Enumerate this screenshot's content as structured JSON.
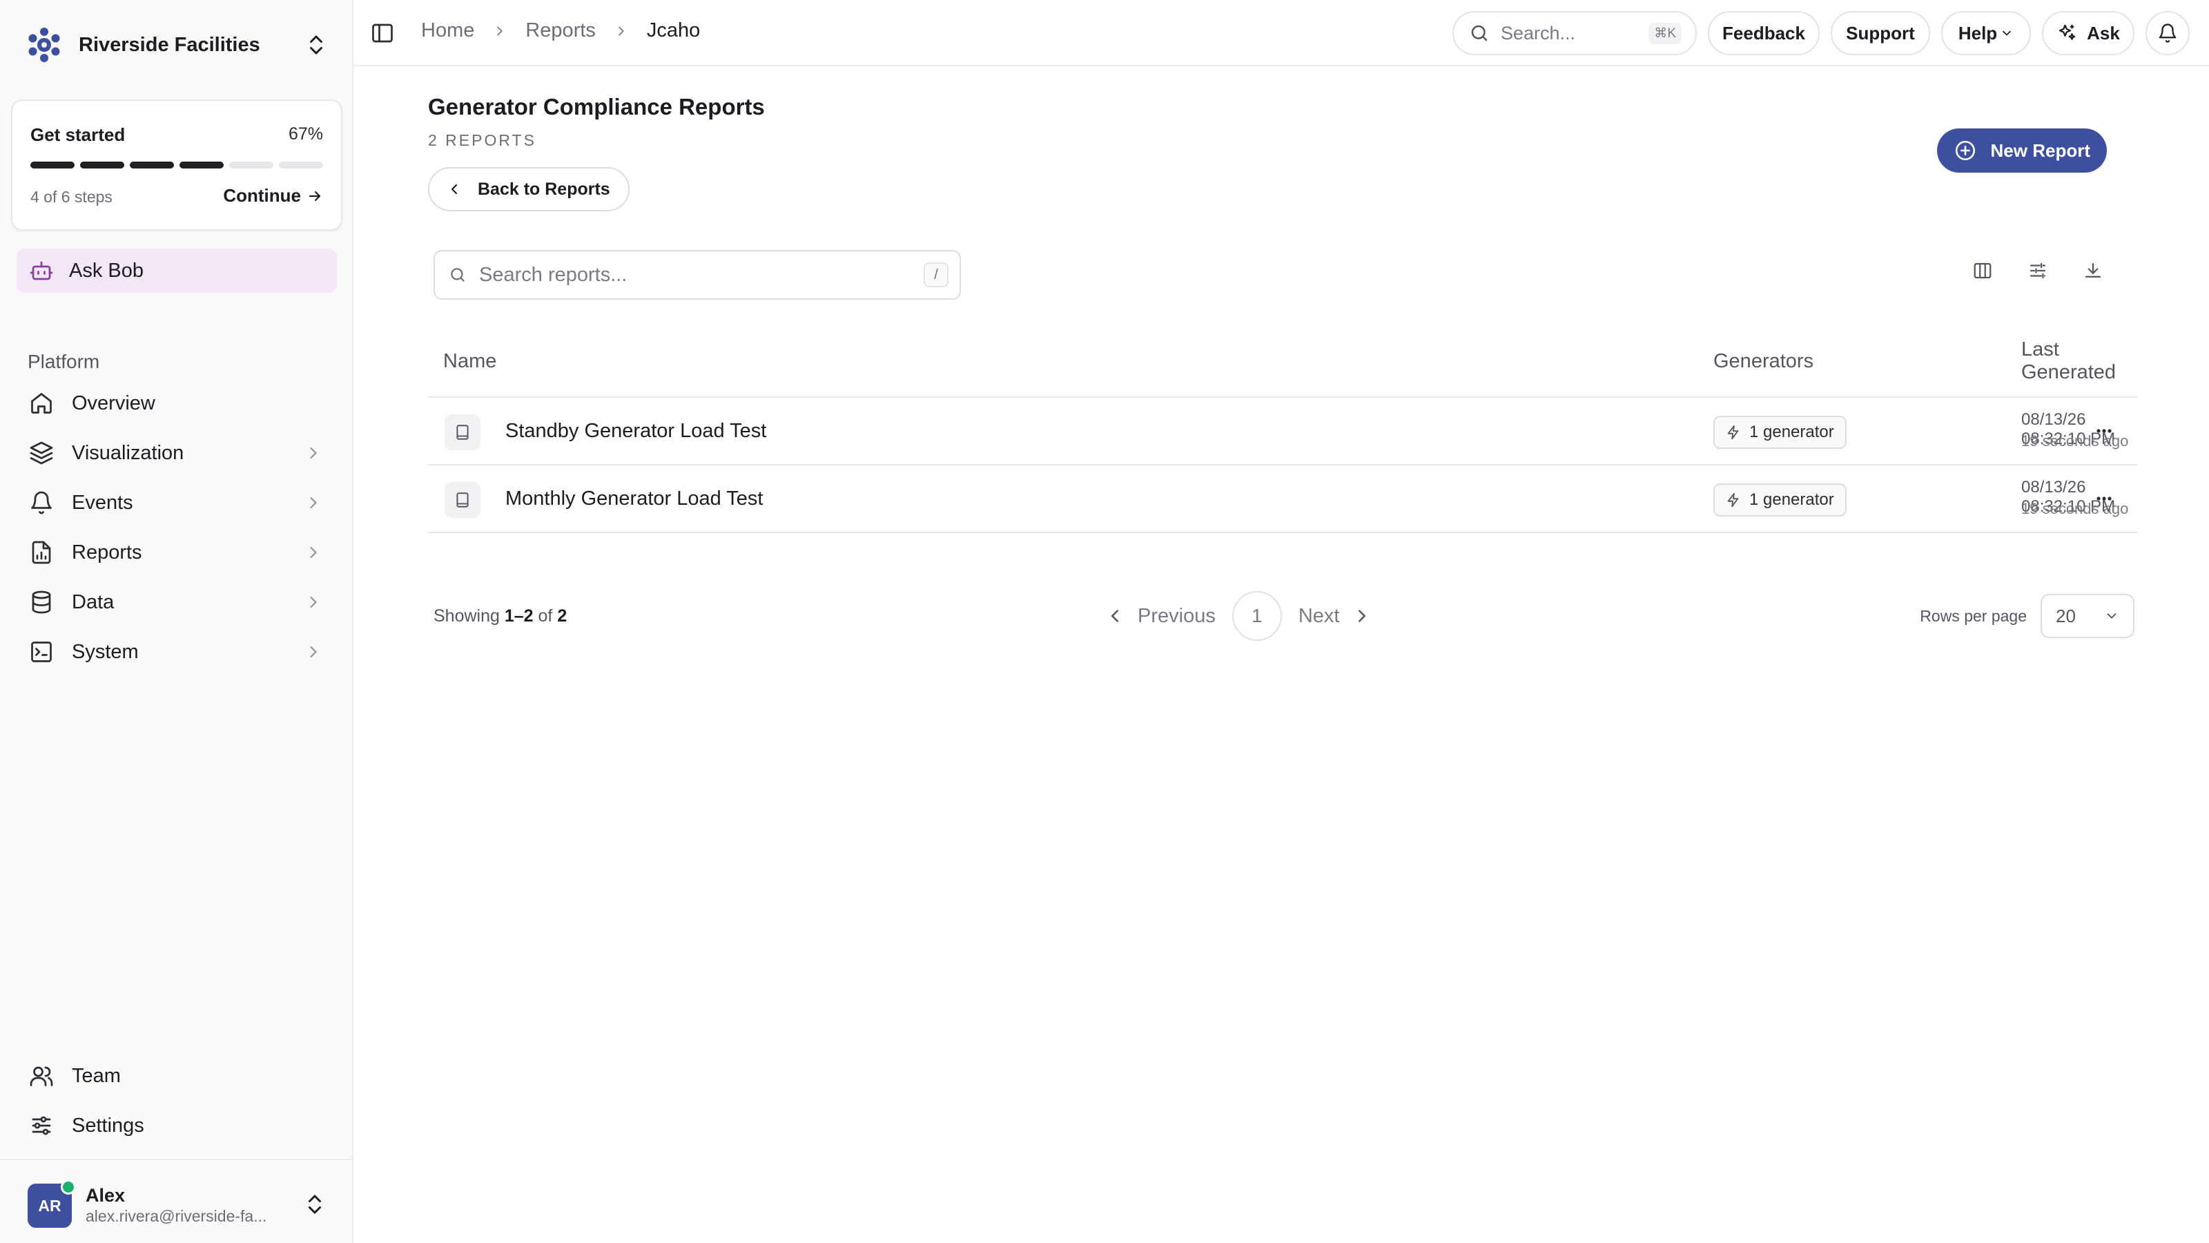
{
  "org": {
    "name": "Riverside Facilities"
  },
  "get_started": {
    "title": "Get started",
    "percent": "67%",
    "progress_fraction": 0.67,
    "steps_done": 4,
    "steps_total": 6,
    "steps_text": "4 of 6 steps",
    "continue_label": "Continue"
  },
  "ask_bob": {
    "label": "Ask Bob"
  },
  "sidebar": {
    "section": "Platform",
    "items": [
      {
        "label": "Overview",
        "icon": "home-icon",
        "has_children": false
      },
      {
        "label": "Visualization",
        "icon": "layers-icon",
        "has_children": true
      },
      {
        "label": "Events",
        "icon": "bell-icon",
        "has_children": true
      },
      {
        "label": "Reports",
        "icon": "report-icon",
        "has_children": true
      },
      {
        "label": "Data",
        "icon": "database-icon",
        "has_children": true
      },
      {
        "label": "System",
        "icon": "terminal-icon",
        "has_children": true
      }
    ],
    "bottom_items": [
      {
        "label": "Team",
        "icon": "users-icon"
      },
      {
        "label": "Settings",
        "icon": "sliders-icon"
      }
    ]
  },
  "user": {
    "initials": "AR",
    "name": "Alex",
    "email": "alex.rivera@riverside-fa...",
    "status_color": "#1bb06b"
  },
  "topbar": {
    "breadcrumbs": [
      "Home",
      "Reports",
      "Jcaho"
    ],
    "search_placeholder": "Search...",
    "search_shortcut": "⌘K",
    "feedback_label": "Feedback",
    "support_label": "Support",
    "help_label": "Help",
    "ask_label": "Ask"
  },
  "page": {
    "title": "Generator Compliance Reports",
    "count_label": "2 REPORTS",
    "back_label": "Back to Reports",
    "new_report_label": "New Report",
    "search_placeholder": "Search reports...",
    "search_shortcut": "/"
  },
  "table": {
    "columns": [
      "Name",
      "Generators",
      "Last Generated"
    ],
    "rows": [
      {
        "name": "Standby Generator Load Test",
        "generators": "1 generator",
        "date": "08/13/26 08:32:10 PM",
        "relative": "19 seconds ago"
      },
      {
        "name": "Monthly Generator Load Test",
        "generators": "1 generator",
        "date": "08/13/26 08:32:10 PM",
        "relative": "19 seconds ago"
      }
    ]
  },
  "pagination": {
    "showing_prefix": "Showing",
    "range": "1–2",
    "of": "of",
    "total": "2",
    "previous_label": "Previous",
    "current_page": "1",
    "next_label": "Next",
    "rows_per_page_label": "Rows per page",
    "rows_per_page_value": "20"
  },
  "colors": {
    "accent": "#3e4fa0",
    "ask_bob_bg": "#f3e6f6",
    "sidebar_bg": "#f9f9fa"
  }
}
